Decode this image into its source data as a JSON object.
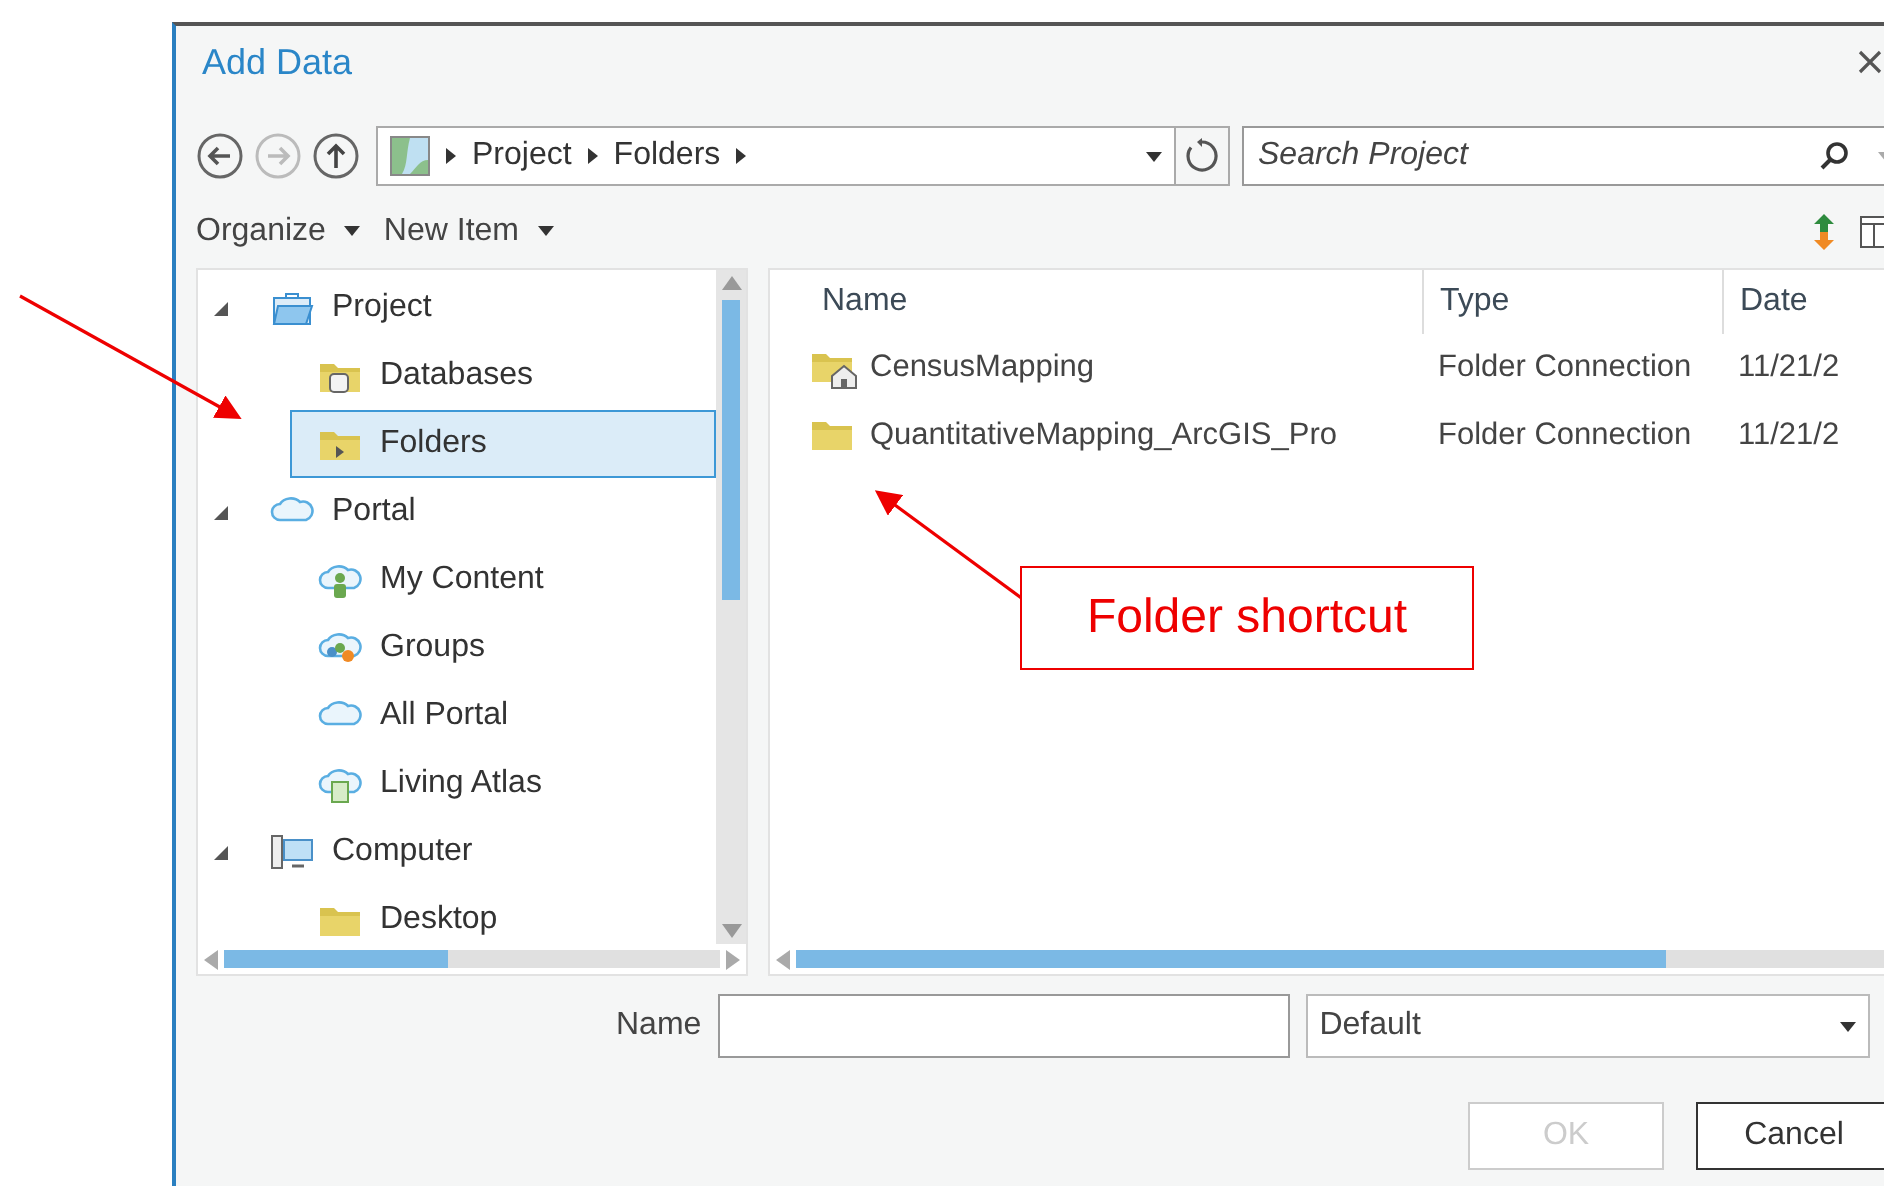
{
  "window": {
    "title": "Add Data"
  },
  "breadcrumb": [
    "Project",
    "Folders"
  ],
  "search": {
    "placeholder": "Search Project"
  },
  "toolbar": [
    {
      "label": "Organize"
    },
    {
      "label": "New Item"
    }
  ],
  "tree": [
    {
      "label": "Project",
      "expanded": true,
      "children": [
        {
          "label": "Databases",
          "selected": false
        },
        {
          "label": "Folders",
          "selected": true
        }
      ]
    },
    {
      "label": "Portal",
      "expanded": true,
      "children": [
        {
          "label": "My Content",
          "selected": false
        },
        {
          "label": "Groups",
          "selected": false
        },
        {
          "label": "All Portal",
          "selected": false
        },
        {
          "label": "Living Atlas",
          "selected": false
        }
      ]
    },
    {
      "label": "Computer",
      "expanded": true,
      "children": [
        {
          "label": "Desktop",
          "selected": false
        }
      ]
    }
  ],
  "table": {
    "columns": [
      "Name",
      "Type",
      "Date"
    ],
    "rows": [
      {
        "name": "CensusMapping",
        "type": "Folder Connection",
        "date": "11/21/2"
      },
      {
        "name": "QuantitativeMapping_ArcGIS_Pro",
        "type": "Folder Connection",
        "date": "11/21/2"
      }
    ]
  },
  "footer": {
    "name_label": "Name",
    "filter": "Default",
    "ok": {
      "label": "OK",
      "disabled": true
    },
    "cancel": {
      "label": "Cancel",
      "disabled": false
    }
  },
  "annotations": [
    {
      "text": "Folder shortcut"
    }
  ]
}
